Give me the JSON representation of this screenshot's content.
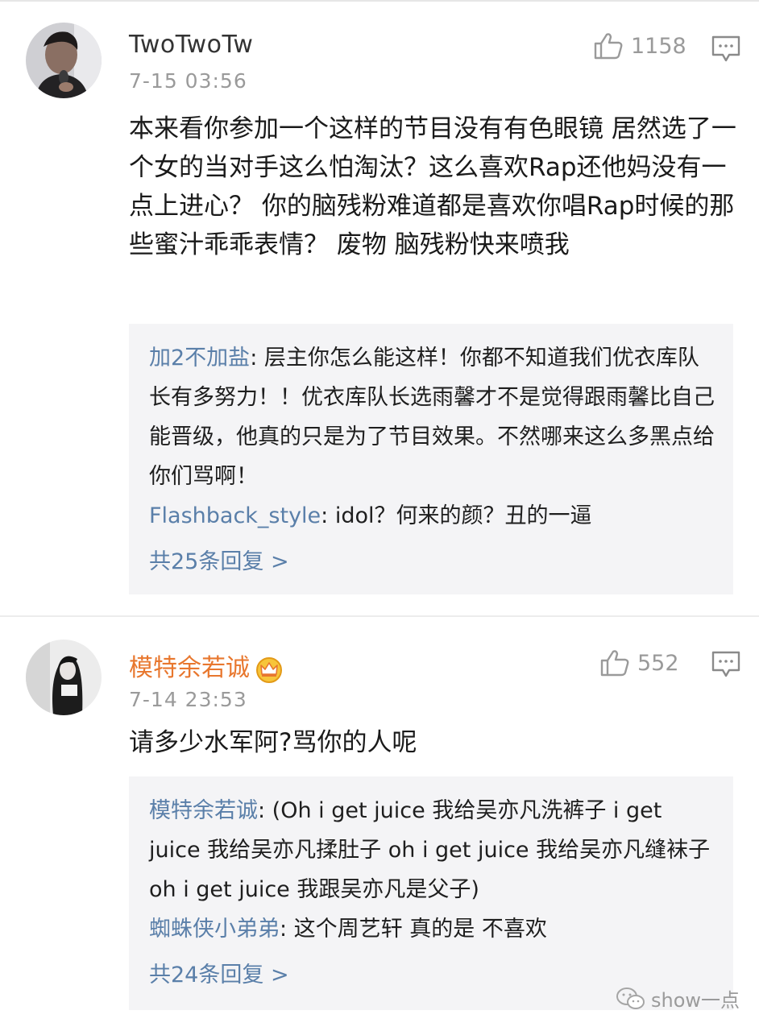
{
  "comments": [
    {
      "username": "TwoTwoTw",
      "time": "7-15 03:56",
      "likes": "1158",
      "text": "本来看你参加一个这样的节目没有有色眼镜 居然选了一个女的当对手这么怕淘汰？这么喜欢Rap还他妈没有一点上进心？ 你的脑残粉难道都是喜欢你唱Rap时候的那些蜜汁乖乖表情？ 废物 脑残粉快来喷我",
      "replies": [
        {
          "user": "加2不加盐",
          "text": ": 层主你怎么能这样！你都不知道我们优衣库队长有多努力！！优衣库队长选雨馨才不是觉得跟雨馨比自己能晋级，他真的只是为了节目效果。不然哪来这么多黑点给你们骂啊！"
        },
        {
          "user": "Flashback_style",
          "text": ": idol？何来的颜？丑的一逼"
        }
      ],
      "more_replies": "共25条回复 >"
    },
    {
      "username": "模特余若诚",
      "time": "7-14 23:53",
      "likes": "552",
      "text": "请多少水军阿?骂你的人呢",
      "replies": [
        {
          "user": "模特余若诚",
          "text": ": (Oh i get juice 我给吴亦凡洗裤子 i get juice 我给吴亦凡揉肚子 oh i get juice 我给吴亦凡缝袜子 oh i get juice 我跟吴亦凡是父子)"
        },
        {
          "user": "蜘蛛侠小弟弟",
          "text": ": 这个周艺轩 真的是 不喜欢"
        }
      ],
      "more_replies": "共24条回复 >"
    }
  ],
  "watermark": "show一点",
  "colors": {
    "username_vip": "#e8772e",
    "reply_user": "#5a7fa9",
    "meta_gray": "#9a9a9a",
    "reply_bg": "#f4f4f6"
  },
  "icons": [
    "thumbs-up-icon",
    "comment-icon",
    "crown-icon",
    "wechat-icon"
  ]
}
